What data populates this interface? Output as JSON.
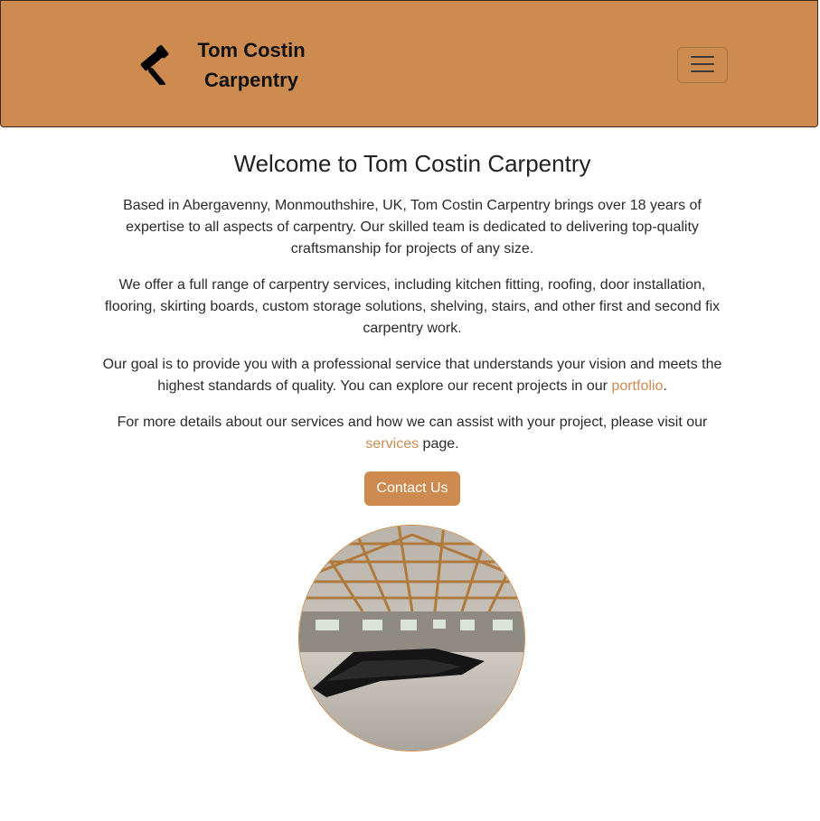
{
  "navbar": {
    "brand_line1": "Tom Costin",
    "brand_line2": "Carpentry",
    "brand_icon": "hammer-icon",
    "menu_icon": "hamburger-menu-icon"
  },
  "main": {
    "heading": "Welcome to Tom Costin Carpentry",
    "para1": "Based in Abergavenny, Monmouthshire, UK, Tom Costin Carpentry brings over 18 years of expertise to all aspects of carpentry. Our skilled team is dedicated to delivering top-quality craftsmanship for projects of any size.",
    "para2": "We offer a full range of carpentry services, including kitchen fitting, roofing, door installation, flooring, skirting boards, custom storage solutions, shelving, stairs, and other first and second fix carpentry work.",
    "para3_before": "Our goal is to provide you with a professional service that understands your vision and meets the highest standards of quality. You can explore our recent projects in our ",
    "para3_link": "portfolio",
    "para3_after": ".",
    "para4_before": "For more details about our services and how we can assist with your project, please visit our ",
    "para4_link": "services",
    "para4_after": " page.",
    "contact_button": "Contact Us"
  },
  "colors": {
    "brand": "#cd8b50",
    "text": "#212529"
  }
}
